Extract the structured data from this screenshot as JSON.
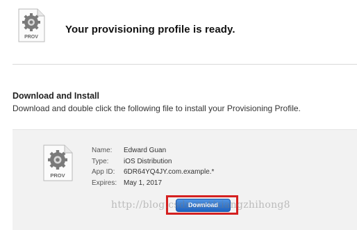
{
  "header": {
    "icon": "provisioning-profile-file-icon",
    "icon_label": "PROV",
    "title": "Your provisioning profile is ready."
  },
  "download_section": {
    "heading": "Download and Install",
    "description": "Download and double click the following file to install your Provisioning Profile."
  },
  "profile": {
    "icon": "provisioning-profile-file-icon",
    "icon_label": "PROV",
    "fields": [
      {
        "label": "Name:",
        "value": "Edward Guan"
      },
      {
        "label": "Type:",
        "value": "iOS Distribution"
      },
      {
        "label": "App ID:",
        "value": "6DR64YQ4JY.com.example.*"
      },
      {
        "label": "Expires:",
        "value": "May 1, 2017"
      }
    ],
    "download_label": "Download"
  },
  "annotation": {
    "highlight_color": "#d42020"
  },
  "watermark": "http://blog.csdn.net/xiangzhihong8"
}
